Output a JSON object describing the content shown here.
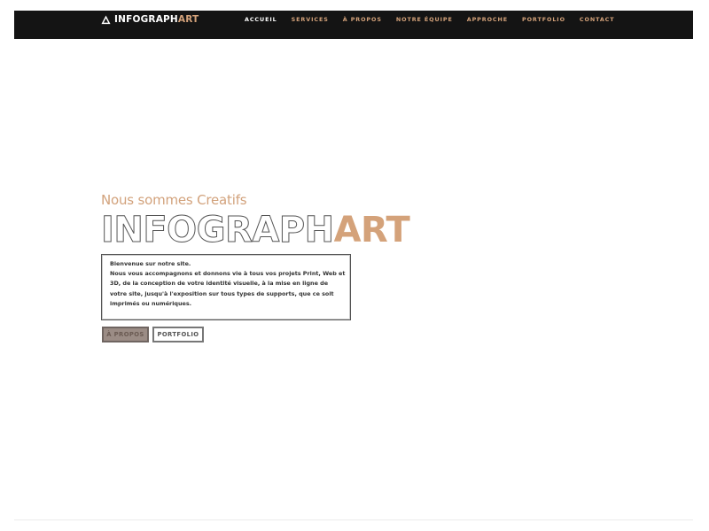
{
  "brand": {
    "part1": "INFOGRAPH",
    "part2": "ART"
  },
  "nav": {
    "items": [
      "ACCUEIL",
      "SERVICES",
      "À PROPOS",
      "NOTRE ÉQUIPE",
      "APPROCHE",
      "PORTFOLIO",
      "CONTACT"
    ]
  },
  "hero": {
    "tagline": "Nous sommes Creatifs",
    "title_part1": "INFOGRAPH",
    "title_part2": "ART",
    "intro_line1": "Bienvenue sur notre site.",
    "intro_line2": "Nous vous accompagnons et donnons vie à tous vos projets Print, Web et 3D, de la conception de votre identité visuelle, à la mise en ligne de votre site, jusqu'à l'exposition sur tous types de supports, que ce soit imprimés ou numériques.",
    "button_primary": "À PROPOS",
    "button_secondary": "PORTFOLIO"
  },
  "colors": {
    "accent": "#d4a27a",
    "navbar": "#141414"
  }
}
